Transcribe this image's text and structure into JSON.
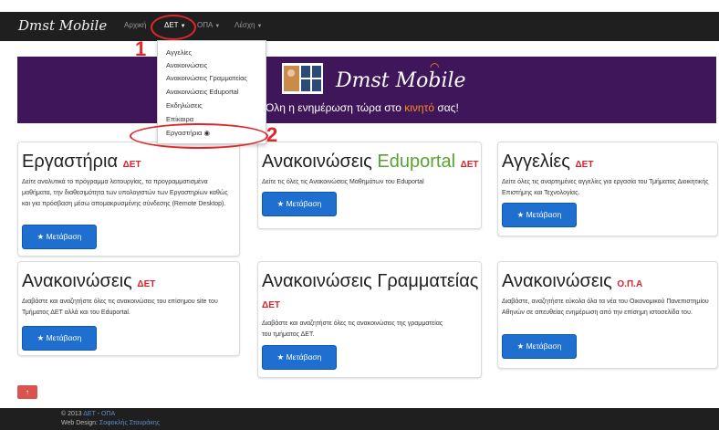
{
  "navbar": {
    "brand": "Dmst Mobile",
    "items": [
      {
        "label": "Αρχική"
      },
      {
        "label": "ΔΕΤ"
      },
      {
        "label": "ΟΠΑ"
      },
      {
        "label": "Λέσχη"
      }
    ]
  },
  "dropdown": {
    "items": [
      "Αγγελίες",
      "Ανακοινώσεις",
      "Ανακοινώσεις Γραμματείας",
      "Ανακοινώσεις Eduportal",
      "Εκδηλώσεις",
      "Επίκαιρα",
      "Εργαστήρια"
    ]
  },
  "annotations": {
    "mark1": "1",
    "mark2": "2",
    "color": "#e0262a"
  },
  "banner": {
    "title": "Dmst Mobile",
    "subtitle_pre": "Όλη η ενημέρωση τώρα στο ",
    "subtitle_hl": "κινητό",
    "subtitle_post": " σας!",
    "bg": "#3e1659"
  },
  "cards": [
    {
      "title": "Εργαστήρια",
      "tag": "ΔΕΤ",
      "desc": "Δείτε αναλυτικά το πρόγραμμα λειτουργίας, τα προγραμματισμένα μαθήματα, την διαθεσιμότητα των υπολογιστών των Εργαστηρίων καθώς και για πρόσβαση μέσω απομακρυσμένης σύνδεσης (Remote Desktop).",
      "button": "Μετάβαση"
    },
    {
      "title": "Ανακοινώσεις",
      "title_green": "Eduportal",
      "tag": "ΔΕΤ",
      "desc": "Δείτε τις όλες τις Ανακοινώσεις Μαθημάτων του Eduportal",
      "button": "Μετάβαση"
    },
    {
      "title": "Αγγελίες",
      "tag": "ΔΕΤ",
      "desc": "Δείτε όλες τις αναρτημένες αγγελίες για εργασία του Τμήματος Διοικητικής Επιστήμης και Τεχνολογίας.",
      "button": "Μετάβαση"
    },
    {
      "title": "Ανακοινώσεις",
      "tag": "ΔΕΤ",
      "desc": "Διαβάστε και αναζητήστε όλες τις ανακοινώσεις του επίσημου site του Τμήματος ΔΕΤ αλλά και του Eduportal.",
      "button": "Μετάβαση"
    },
    {
      "title": "Ανακοινώσεις Γραμματείας",
      "tag": "ΔΕΤ",
      "desc": "Διαβάστε και αναζητήστε όλες τις ανακοινώσεις της γραμματείας του τμήματος ΔΕΤ.",
      "button": "Μετάβαση"
    },
    {
      "title": "Ανακοινώσεις",
      "tag": "Ο.Π.Α",
      "desc": "Διαβάστε, αναζητήστε εύκολα όλα τα νέα του Οικονομικού Πανεπιστημίου Αθηνών σε απευθείας ενημέρωση από την επίσημη ιστοσελίδα του.",
      "button": "Μετάβαση"
    }
  ],
  "up_button": "↑",
  "footer": {
    "year": "© 2013",
    "link1": "ΔΕΤ",
    "sep": " - ",
    "link2": "ΟΠΑ",
    "design_label": "Web Design:",
    "designer": "Σοφοκλής Σταυράκης"
  }
}
